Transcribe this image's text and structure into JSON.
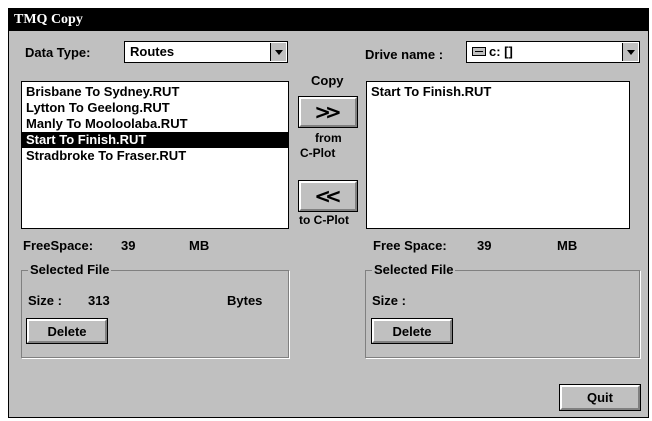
{
  "window": {
    "title": "TMQ  Copy"
  },
  "left": {
    "data_type_label": "Data Type:",
    "data_type_value": "Routes",
    "files": [
      {
        "name": "Brisbane To Sydney.RUT",
        "selected": false
      },
      {
        "name": "Lytton To Geelong.RUT",
        "selected": false
      },
      {
        "name": "Manly To Mooloolaba.RUT",
        "selected": false
      },
      {
        "name": "Start To Finish.RUT",
        "selected": true
      },
      {
        "name": "Stradbroke To Fraser.RUT",
        "selected": false
      }
    ],
    "free_space_label": "FreeSpace:",
    "free_space_value": "39",
    "free_space_unit": "MB",
    "selected_group_title": "Selected File",
    "size_label": "Size :",
    "size_value": "313",
    "size_unit": "Bytes",
    "delete_label": "Delete"
  },
  "center": {
    "copy_label": "Copy",
    "to_right_icon": ">>",
    "from_label": "from",
    "cplot_label": "C-Plot",
    "to_left_icon": "<<",
    "to_cplot_label": "to C-Plot"
  },
  "right": {
    "drive_name_label": "Drive name :",
    "drive_value": "c: []",
    "files": [
      {
        "name": "Start To Finish.RUT",
        "selected": false
      }
    ],
    "free_space_label": "Free Space:",
    "free_space_value": "39",
    "free_space_unit": "MB",
    "selected_group_title": "Selected File",
    "size_label": "Size :",
    "size_value": "",
    "delete_label": "Delete"
  },
  "footer": {
    "quit_label": "Quit"
  },
  "icons": {
    "drive": "drive-icon",
    "dropdown": "chevron-down-icon"
  }
}
